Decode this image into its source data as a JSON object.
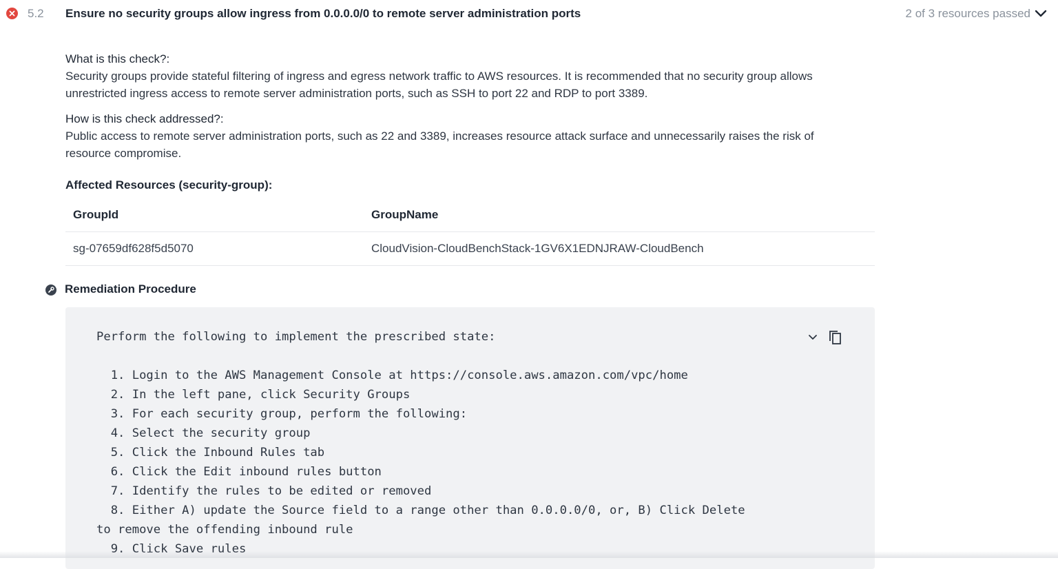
{
  "check": {
    "number": "5.2",
    "title": "Ensure no security groups allow ingress from 0.0.0.0/0 to remote server administration ports",
    "resources_passed": "2 of 3 resources passed",
    "status": "failed",
    "status_color": "#e2473f"
  },
  "what": {
    "label": "What is this check?:",
    "line1": "Security groups provide stateful filtering of ingress and egress network traffic to AWS resources. It is recommended that no security group allows",
    "line2": "unrestricted ingress access to remote server administration ports, such as SSH to port 22 and RDP to port 3389."
  },
  "how": {
    "label": "How is this check addressed?:",
    "line1": "Public access to remote server administration ports, such as 22 and 3389, increases resource attack surface and unnecessarily raises the risk of",
    "line2": "resource compromise."
  },
  "affected": {
    "title": "Affected Resources (security-group):",
    "columns": [
      "GroupId",
      "GroupName"
    ],
    "rows": [
      [
        "sg-07659df628f5d5070",
        "CloudVision-CloudBenchStack-1GV6X1EDNJRAW-CloudBench"
      ]
    ]
  },
  "remediation": {
    "title": "Remediation Procedure",
    "intro": "Perform the following to implement the prescribed state:",
    "steps": [
      "  1. Login to the AWS Management Console at https://console.aws.amazon.com/vpc/home",
      "  2. In the left pane, click Security Groups",
      "  3. For each security group, perform the following:",
      "  4. Select the security group",
      "  5. Click the Inbound Rules tab",
      "  6. Click the Edit inbound rules button",
      "  7. Identify the rules to be edited or removed",
      "  8. Either A) update the Source field to a range other than 0.0.0.0/0, or, B) Click Delete",
      "to remove the offending inbound rule",
      "  9. Click Save rules"
    ]
  },
  "icons": {
    "status": "error-circle-icon",
    "collapse": "chevron-down-icon",
    "remediation": "wrench-circle-icon",
    "copy": "copy-icon"
  }
}
